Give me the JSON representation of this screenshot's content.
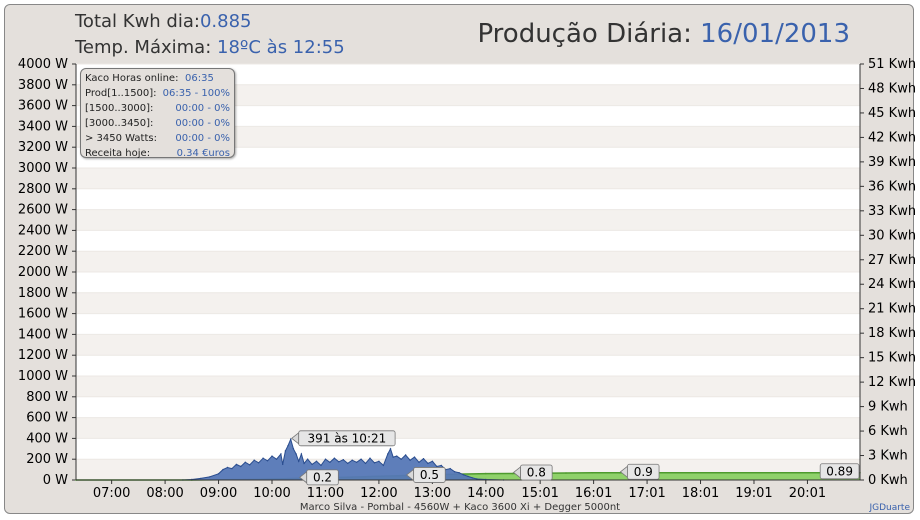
{
  "header": {
    "total_label": "Total Kwh dia:",
    "total_value": "0.885",
    "temp_label": "Temp. Máxima:",
    "temp_value": "18ºC às 12:55",
    "title_label": "Produção Diária:",
    "title_date": "16/01/2013"
  },
  "info_box": {
    "rows": [
      {
        "label": "Kaco Horas online:",
        "value": "06:35"
      },
      {
        "label": "Prod[1..1500]:",
        "value": "06:35 - 100%"
      },
      {
        "label": "[1500..3000]:",
        "value": "00:00 - 0%"
      },
      {
        "label": "[3000..3450]:",
        "value": "00:00 - 0%"
      },
      {
        "label": "> 3450 Watts:",
        "value": "00:00 - 0%"
      },
      {
        "label": "Receita hoje:",
        "value": "0.34 €uros"
      }
    ]
  },
  "footer": {
    "text": "Marco Silva - Pombal - 4560W + Kaco 3600 Xi + Degger 5000nt",
    "credit": "JGDuarte"
  },
  "colors": {
    "power_fill": "#5577b6",
    "power_stroke": "#2a4d8f",
    "energy_fill": "#8fd16a",
    "energy_stroke": "#4e9a2e",
    "band": "#f4f1ee",
    "grid": "#ffffff"
  },
  "chart_data": {
    "type": "area",
    "x_axis": {
      "tick_labels": [
        "07:00",
        "08:00",
        "09:00",
        "10:00",
        "11:00",
        "12:00",
        "13:00",
        "14:00",
        "15:01",
        "16:01",
        "17:01",
        "18:01",
        "19:01",
        "20:01"
      ],
      "range": [
        "06:20",
        "21:00"
      ]
    },
    "y_left": {
      "unit": "W",
      "range": [
        0,
        4000
      ],
      "tick_labels": [
        "0 W",
        "200 W",
        "400 W",
        "600 W",
        "800 W",
        "1000 W",
        "1200 W",
        "1400 W",
        "1600 W",
        "1800 W",
        "2000 W",
        "2200 W",
        "2400 W",
        "2600 W",
        "2800 W",
        "3000 W",
        "3200 W",
        "3400 W",
        "3600 W",
        "3800 W",
        "4000 W"
      ]
    },
    "y_right": {
      "unit": "Kwh",
      "range": [
        0,
        51
      ],
      "tick_labels": [
        "0 Kwh",
        "3 Kwh",
        "6 Kwh",
        "9 Kwh",
        "12 Kwh",
        "15 Kwh",
        "18 Kwh",
        "21 Kwh",
        "24 Kwh",
        "27 Kwh",
        "30 Kwh",
        "33 Kwh",
        "36 Kwh",
        "39 Kwh",
        "42 Kwh",
        "45 Kwh",
        "48 Kwh",
        "51 Kwh"
      ]
    },
    "grid": true,
    "series": [
      {
        "kind": "power",
        "axis": "left",
        "points": [
          [
            "08:20",
            0
          ],
          [
            "08:30",
            5
          ],
          [
            "08:40",
            15
          ],
          [
            "08:50",
            30
          ],
          [
            "09:00",
            60
          ],
          [
            "09:05",
            100
          ],
          [
            "09:10",
            120
          ],
          [
            "09:15",
            110
          ],
          [
            "09:20",
            150
          ],
          [
            "09:25",
            130
          ],
          [
            "09:30",
            170
          ],
          [
            "09:35",
            145
          ],
          [
            "09:40",
            190
          ],
          [
            "09:45",
            165
          ],
          [
            "09:50",
            210
          ],
          [
            "09:55",
            185
          ],
          [
            "10:00",
            230
          ],
          [
            "10:05",
            200
          ],
          [
            "10:10",
            250
          ],
          [
            "10:12",
            150
          ],
          [
            "10:15",
            280
          ],
          [
            "10:18",
            330
          ],
          [
            "10:21",
            391
          ],
          [
            "10:24",
            300
          ],
          [
            "10:27",
            250
          ],
          [
            "10:30",
            180
          ],
          [
            "10:33",
            250
          ],
          [
            "10:36",
            160
          ],
          [
            "10:40",
            200
          ],
          [
            "10:45",
            150
          ],
          [
            "10:50",
            180
          ],
          [
            "10:55",
            140
          ],
          [
            "11:00",
            200
          ],
          [
            "11:05",
            170
          ],
          [
            "11:10",
            210
          ],
          [
            "11:15",
            175
          ],
          [
            "11:20",
            195
          ],
          [
            "11:25",
            160
          ],
          [
            "11:30",
            190
          ],
          [
            "11:35",
            170
          ],
          [
            "11:40",
            200
          ],
          [
            "11:45",
            160
          ],
          [
            "11:50",
            210
          ],
          [
            "11:55",
            165
          ],
          [
            "12:00",
            180
          ],
          [
            "12:05",
            140
          ],
          [
            "12:10",
            250
          ],
          [
            "12:13",
            300
          ],
          [
            "12:16",
            220
          ],
          [
            "12:20",
            230
          ],
          [
            "12:25",
            200
          ],
          [
            "12:30",
            240
          ],
          [
            "12:35",
            190
          ],
          [
            "12:40",
            220
          ],
          [
            "12:45",
            170
          ],
          [
            "12:50",
            205
          ],
          [
            "12:55",
            160
          ],
          [
            "13:00",
            180
          ],
          [
            "13:05",
            130
          ],
          [
            "13:10",
            140
          ],
          [
            "13:15",
            100
          ],
          [
            "13:20",
            110
          ],
          [
            "13:25",
            80
          ],
          [
            "13:30",
            70
          ],
          [
            "13:35",
            50
          ],
          [
            "13:40",
            35
          ],
          [
            "13:45",
            20
          ],
          [
            "13:50",
            10
          ],
          [
            "14:00",
            5
          ],
          [
            "14:20",
            0
          ]
        ]
      },
      {
        "kind": "energy",
        "axis": "right",
        "points": [
          [
            "06:20",
            0
          ],
          [
            "08:30",
            0
          ],
          [
            "09:00",
            0.02
          ],
          [
            "09:30",
            0.06
          ],
          [
            "10:00",
            0.12
          ],
          [
            "10:30",
            0.2
          ],
          [
            "11:00",
            0.28
          ],
          [
            "11:30",
            0.36
          ],
          [
            "12:00",
            0.45
          ],
          [
            "12:30",
            0.55
          ],
          [
            "13:00",
            0.64
          ],
          [
            "13:30",
            0.72
          ],
          [
            "14:00",
            0.78
          ],
          [
            "14:30",
            0.8
          ],
          [
            "15:00",
            0.83
          ],
          [
            "15:30",
            0.86
          ],
          [
            "16:00",
            0.88
          ],
          [
            "16:30",
            0.885
          ],
          [
            "21:00",
            0.885
          ]
        ]
      }
    ],
    "annotations": [
      {
        "text": "391 às 10:21",
        "x": "10:21",
        "y": 391,
        "axis": "left"
      },
      {
        "text": "0.2",
        "x": "10:30",
        "y": 0.2,
        "axis": "right"
      },
      {
        "text": "0.5",
        "x": "12:30",
        "y": 0.5,
        "axis": "right"
      },
      {
        "text": "0.8",
        "x": "14:30",
        "y": 0.8,
        "axis": "right"
      },
      {
        "text": "0.9",
        "x": "16:30",
        "y": 0.885,
        "axis": "right"
      },
      {
        "text": "0.89",
        "x": "21:00",
        "y": 0.885,
        "axis": "right"
      }
    ]
  }
}
